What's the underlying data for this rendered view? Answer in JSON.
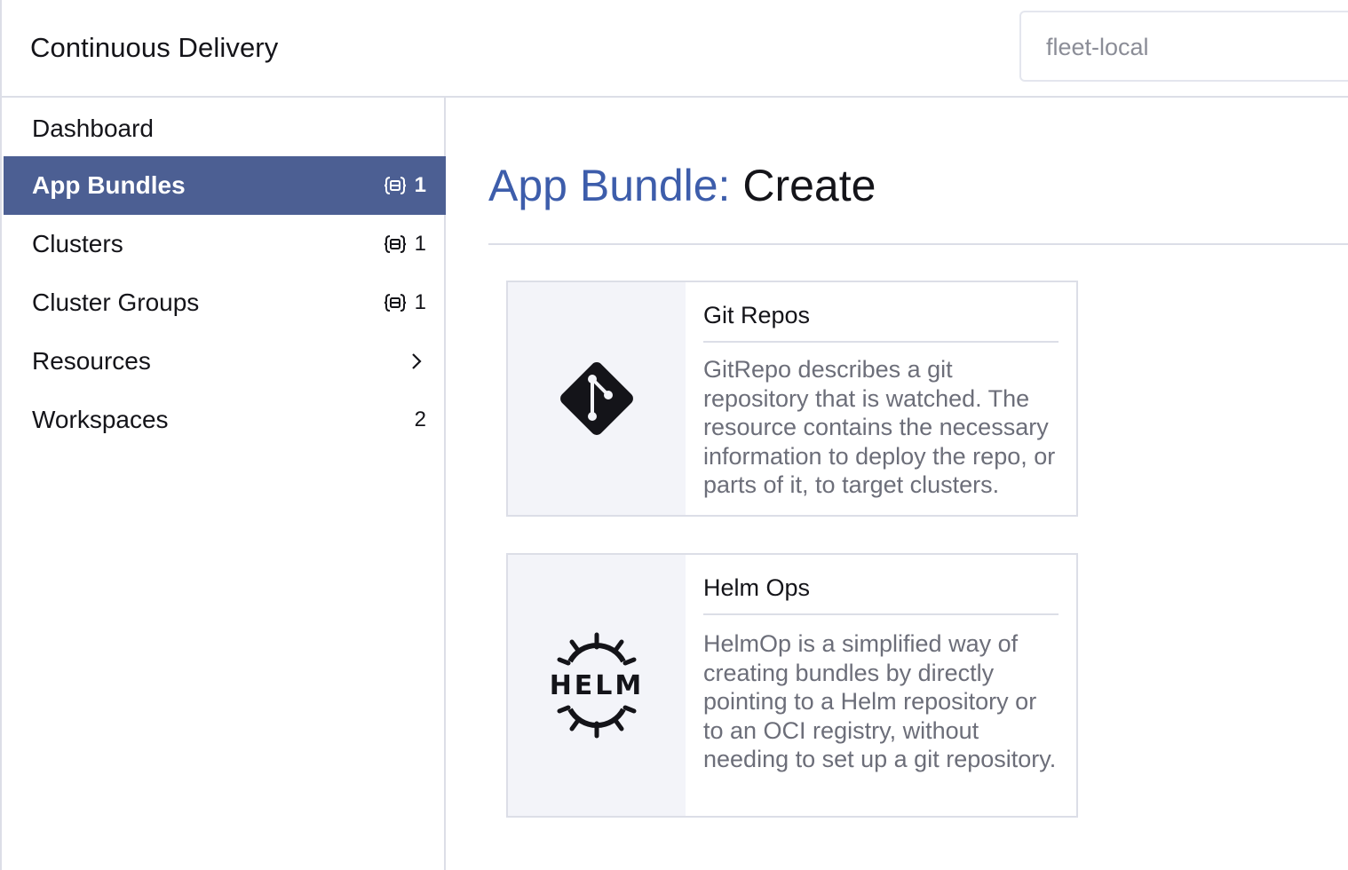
{
  "header": {
    "title": "Continuous Delivery",
    "namespace_value": "fleet-local"
  },
  "sidebar": {
    "items": [
      {
        "label": "Dashboard",
        "count": "",
        "icon": "",
        "active": false
      },
      {
        "label": "App Bundles",
        "count": "1",
        "icon": "namespaced-icon",
        "active": true
      },
      {
        "label": "Clusters",
        "count": "1",
        "icon": "namespaced-icon",
        "active": false
      },
      {
        "label": "Cluster Groups",
        "count": "1",
        "icon": "namespaced-icon",
        "active": false
      },
      {
        "label": "Resources",
        "count": "",
        "icon": "chevron-right-icon",
        "active": false
      },
      {
        "label": "Workspaces",
        "count": "2",
        "icon": "",
        "active": false
      }
    ]
  },
  "main": {
    "title_prefix": "App Bundle:",
    "title_suffix": "Create",
    "cards": [
      {
        "title": "Git Repos",
        "icon": "git-icon",
        "description": "GitRepo describes a git repository that is watched. The resource contains the necessary information to deploy the repo, or parts of it, to target clusters."
      },
      {
        "title": "Helm Ops",
        "icon": "helm-icon",
        "description": "HelmOp is a simplified way of creating bundles by directly pointing to a Helm repository or to an OCI registry, without needing to set up a git repository.",
        "logo_text": "HELM"
      }
    ]
  },
  "colors": {
    "accent": "#3d5dab",
    "active_nav_bg": "#4c5f93",
    "card_logo_bg": "#f3f4f9",
    "border": "#dcdee7",
    "muted_text": "#6c6e79"
  }
}
